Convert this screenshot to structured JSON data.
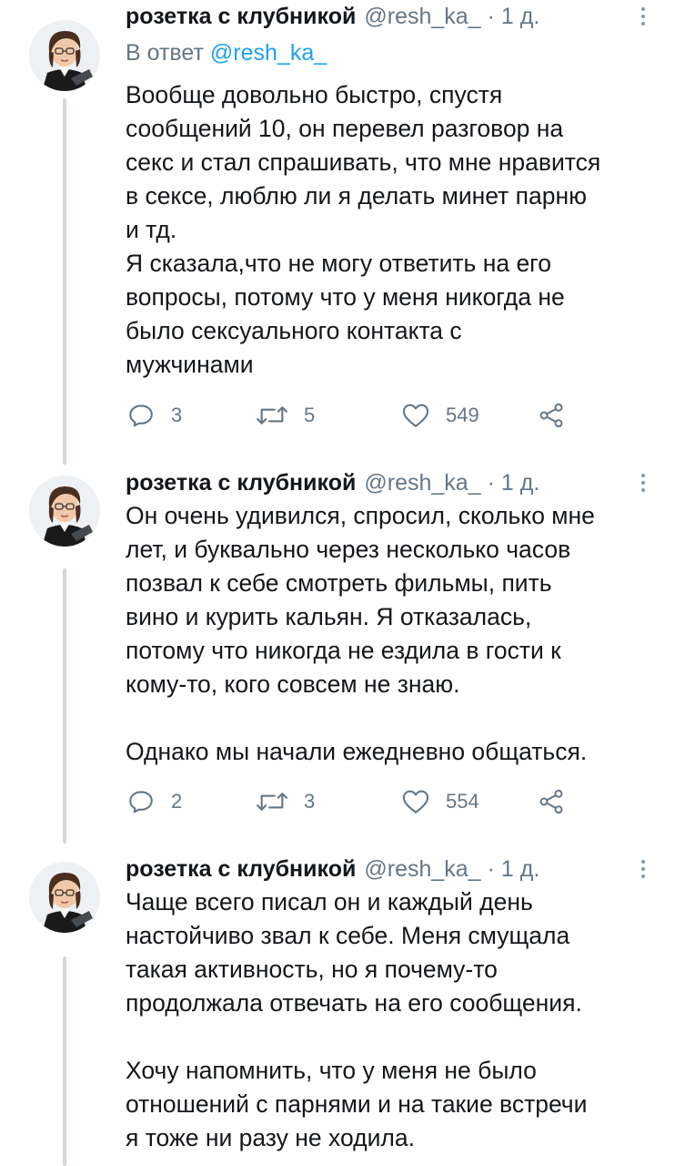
{
  "author": {
    "display_name": "розетка с клубникой",
    "handle": "@resh_ka_",
    "separator": "·",
    "time": "1 д."
  },
  "reply_prefix": "В ответ",
  "reply_mention": "@resh_ka_",
  "icons": {
    "reply": "reply-icon",
    "retweet": "retweet-icon",
    "like": "heart-icon",
    "share": "share-icon",
    "more": "more-vertical-icon"
  },
  "colors": {
    "text": "#14171a",
    "secondary": "#657786",
    "accent": "#1da1f2",
    "thread_line": "#cfd9de"
  },
  "tweets": [
    {
      "lines": [
        "Вообще довольно быстро, спустя",
        "сообщений 10, он перевел разговор на",
        "секс и стал спрашивать, что мне нравится",
        "в сексе, люблю ли я делать минет парню",
        "и тд.",
        "Я сказала,что не могу ответить на его",
        "вопросы, потому что у меня никогда не",
        "было сексуального контакта с",
        "мужчинами"
      ],
      "replies": "3",
      "retweets": "5",
      "likes": "549"
    },
    {
      "lines": [
        "Он очень удивился, спросил, сколько мне",
        "лет, и буквально через несколько часов",
        "позвал к себе смотреть фильмы, пить",
        "вино и курить кальян. Я отказалась,",
        "потому что никогда не ездила в гости к",
        "кому-то, кого совсем не знаю.",
        "",
        "Однако мы начали ежедневно общаться."
      ],
      "replies": "2",
      "retweets": "3",
      "likes": "554"
    },
    {
      "lines": [
        "Чаще всего писал он и каждый день",
        "настойчиво звал к себе. Меня смущала",
        "такая активность, но я почему-то",
        "продолжала отвечать на его сообщения.",
        "",
        "Хочу напомнить, что у меня не было",
        "отношений с парнями и на такие встречи",
        "я тоже ни разу не ходила."
      ]
    }
  ]
}
